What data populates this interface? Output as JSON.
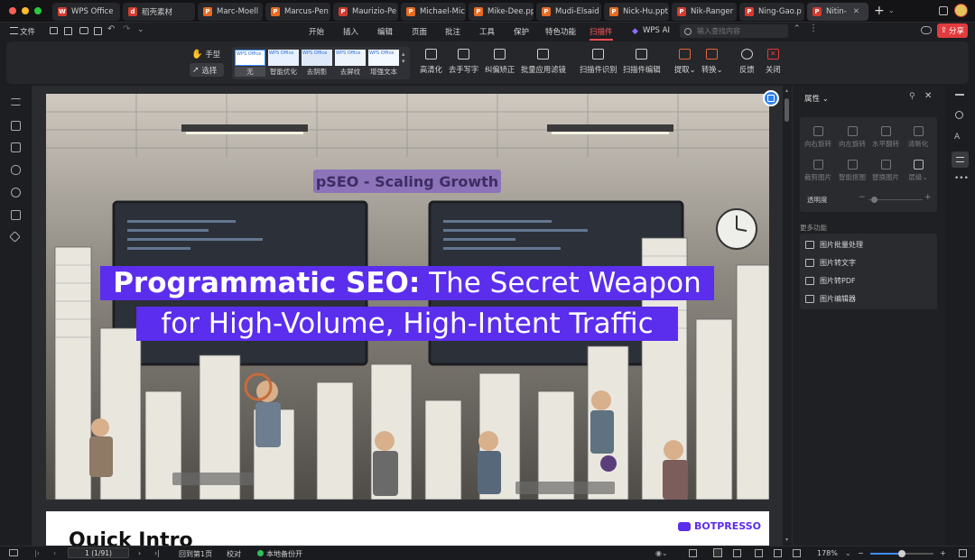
{
  "window": {
    "tabs": [
      {
        "label": "WPS Office",
        "color": "#d33b2e"
      },
      {
        "label": "稻壳素材",
        "color": "#d33b2e"
      },
      {
        "label": "Marc-Moell",
        "color": "#e76b22"
      },
      {
        "label": "Marcus-Pen",
        "color": "#e76b22"
      },
      {
        "label": "Maurizio-Pe",
        "color": "#d33b2e"
      },
      {
        "label": "Michael-Mic",
        "color": "#e76b22"
      },
      {
        "label": "Mike-Dee.pp",
        "color": "#e76b22"
      },
      {
        "label": "Mudi-Elsaid",
        "color": "#e76b22"
      },
      {
        "label": "Nick-Hu.ppt",
        "color": "#e76b22"
      },
      {
        "label": "Nik-Ranger",
        "color": "#d33b2e"
      },
      {
        "label": "Ning-Gao.p",
        "color": "#d33b2e"
      },
      {
        "label": "Nitin-",
        "color": "#d33b2e"
      }
    ],
    "new_tab": "+"
  },
  "menubar": {
    "file": "文件",
    "items": [
      "开始",
      "插入",
      "编辑",
      "页面",
      "批注",
      "工具",
      "保护",
      "特色功能",
      "扫描件",
      "WPS AI"
    ],
    "active": "扫描件",
    "search_placeholder": "输入查找内容",
    "share": "分享"
  },
  "ribbon": {
    "hand": "手型",
    "select": "选择",
    "filters": [
      "无",
      "智能优化",
      "去阴影",
      "去屏纹",
      "增强文本"
    ],
    "filter_thumb_text": "WPS Office",
    "buttons": [
      "高清化",
      "去手写字",
      "纠偏矫正",
      "批量应用滤镜",
      "扫描件识别",
      "扫描件编辑",
      "提取",
      "转换",
      "反馈",
      "关闭"
    ]
  },
  "document": {
    "title_bold": "Programmatic SEO:",
    "title_rest": " The Secret Weapon",
    "title_line2": "for High-Volume, High-Intent Traffic",
    "sign": "pSEO - Scaling Growth",
    "next_heading": "Quick Intro",
    "brand": "BOTPRESSO"
  },
  "panel": {
    "title": "属性",
    "tools": [
      "向右旋转",
      "向左旋转",
      "水平翻转",
      "清晰化",
      "裁剪图片",
      "智能抠图",
      "替换图片",
      "层级"
    ],
    "opacity": "透明度",
    "more": "更多功能",
    "more_items": [
      "图片批量处理",
      "图片转文字",
      "图片转PDF",
      "图片编辑器"
    ]
  },
  "status": {
    "page": "1 (1/91)",
    "back": "回到第1页",
    "proof": "校对",
    "backup": "本地备份开",
    "zoom": "178%"
  }
}
